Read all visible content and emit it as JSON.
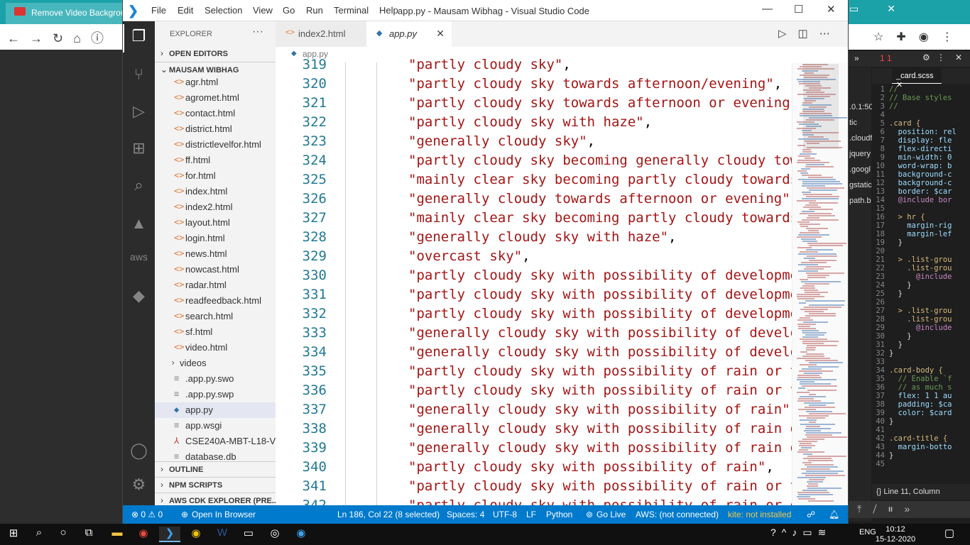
{
  "browser": {
    "tab_title": "Remove Video Backgrou"
  },
  "window": {
    "title": "app.py - Mausam Wibhag - Visual Studio Code",
    "menu": [
      "File",
      "Edit",
      "Selection",
      "View",
      "Go",
      "Run",
      "Terminal",
      "Help"
    ]
  },
  "activity_bar": [
    "explorer-icon",
    "source-control-icon",
    "run-debug-icon",
    "extensions-icon",
    "search-icon",
    "azure-icon",
    "aws-icon",
    "docker-icon",
    "account-icon",
    "settings-gear-icon"
  ],
  "sidebar": {
    "header": "EXPLORER",
    "more": "···",
    "open_editors": "OPEN EDITORS",
    "project": "MAUSAM WIBHAG",
    "files": [
      {
        "name": "agr.html",
        "type": "html"
      },
      {
        "name": "agromet.html",
        "type": "html"
      },
      {
        "name": "contact.html",
        "type": "html"
      },
      {
        "name": "district.html",
        "type": "html"
      },
      {
        "name": "districtlevelfor.html",
        "type": "html"
      },
      {
        "name": "ff.html",
        "type": "html"
      },
      {
        "name": "for.html",
        "type": "html"
      },
      {
        "name": "index.html",
        "type": "html"
      },
      {
        "name": "index2.html",
        "type": "html"
      },
      {
        "name": "layout.html",
        "type": "html"
      },
      {
        "name": "login.html",
        "type": "html"
      },
      {
        "name": "news.html",
        "type": "html"
      },
      {
        "name": "nowcast.html",
        "type": "html"
      },
      {
        "name": "radar.html",
        "type": "html"
      },
      {
        "name": "readfeedback.html",
        "type": "html"
      },
      {
        "name": "search.html",
        "type": "html"
      },
      {
        "name": "sf.html",
        "type": "html"
      },
      {
        "name": "video.html",
        "type": "html"
      },
      {
        "name": "videos",
        "type": "folder"
      },
      {
        "name": ".app.py.swo",
        "type": "text"
      },
      {
        "name": ".app.py.swp",
        "type": "text"
      },
      {
        "name": "app.py",
        "type": "python"
      },
      {
        "name": "app.wsgi",
        "type": "text"
      },
      {
        "name": "CSE240A-MBT-L18-Vi...",
        "type": "pdf"
      },
      {
        "name": "database.db",
        "type": "text"
      }
    ],
    "outline": "OUTLINE",
    "npm_scripts": "NPM SCRIPTS",
    "aws_cdk": "AWS CDK EXPLORER (PRE..."
  },
  "tabs": [
    {
      "label": "index2.html",
      "icon": "<>"
    },
    {
      "label": "app.py",
      "icon": "py"
    }
  ],
  "breadcrumb": "app.py",
  "code": {
    "lines": [
      {
        "n": "319",
        "text": "\"partly cloudy sky\"",
        "comma": ","
      },
      {
        "n": "320",
        "text": "\"partly cloudy sky towards afternoon/evening\"",
        "comma": ","
      },
      {
        "n": "321",
        "text": "\"partly cloudy sky towards afternoon or evening\"",
        "comma": ","
      },
      {
        "n": "322",
        "text": "\"partly cloudy sky with haze\"",
        "comma": ","
      },
      {
        "n": "323",
        "text": "\"generally cloudy sky\"",
        "comma": ","
      },
      {
        "n": "324",
        "text": "\"partly cloudy sky becoming generally cloudy towar",
        "comma": ""
      },
      {
        "n": "325",
        "text": "\"mainly clear sky becoming partly cloudy towards a",
        "comma": ""
      },
      {
        "n": "326",
        "text": "\"generally cloudy towards afternoon or evening\"",
        "comma": ","
      },
      {
        "n": "327",
        "text": "\"mainly clear sky becoming partly cloudy towards a",
        "comma": ""
      },
      {
        "n": "328",
        "text": "\"generally cloudy sky with haze\"",
        "comma": ","
      },
      {
        "n": "329",
        "text": "\"overcast sky\"",
        "comma": ","
      },
      {
        "n": "330",
        "text": "\"partly cloudy sky with possibility of development",
        "comma": ""
      },
      {
        "n": "331",
        "text": "\"partly cloudy sky with possibility of development",
        "comma": ""
      },
      {
        "n": "332",
        "text": "\"partly cloudy sky with possibility of development",
        "comma": ""
      },
      {
        "n": "333",
        "text": "\"generally cloudy sky with possibility of developm",
        "comma": ""
      },
      {
        "n": "334",
        "text": "\"generally cloudy sky with possibility of developm",
        "comma": ""
      },
      {
        "n": "335",
        "text": "\"partly cloudy sky with possibility of rain or thu",
        "comma": ""
      },
      {
        "n": "336",
        "text": "\"partly cloudy sky with possibility of rain or thu",
        "comma": ""
      },
      {
        "n": "337",
        "text": "\"generally cloudy sky with possibility of rain\"",
        "comma": ","
      },
      {
        "n": "338",
        "text": "\"generally cloudy sky with possibility of rain or",
        "comma": ""
      },
      {
        "n": "339",
        "text": "\"generally cloudy sky with possibility of rain or",
        "comma": ""
      },
      {
        "n": "340",
        "text": "\"partly cloudy sky with possibility of rain\"",
        "comma": ","
      },
      {
        "n": "341",
        "text": "\"partly cloudy sky with possibility of rain or thu",
        "comma": ""
      },
      {
        "n": "342",
        "text": "\"partly cloudy sky with possibility of rain or du",
        "comma": ""
      }
    ]
  },
  "statusbar": {
    "errors": "⊗ 0 ⚠ 0",
    "open_browser": "Open In Browser",
    "position": "Ln 186, Col 22 (8 selected)",
    "spaces": "Spaces: 4",
    "encoding": "UTF-8",
    "eol": "LF",
    "language": "Python",
    "go_live": "Go Live",
    "aws": "AWS: (not connected)",
    "kite": "kite: not installed"
  },
  "devtools": {
    "file_tab": "_card.scss",
    "counts": "1 1",
    "status": "Line 11, Column",
    "strip_text": [
      ".0.1:50",
      "tic",
      "",
      "",
      ".cloudf",
      "jquery",
      ".googl",
      "gstatic",
      "path.b"
    ],
    "scss_lines": [
      {
        "n": "1",
        "t": "//",
        "c": "#6a9955"
      },
      {
        "n": "2",
        "t": "// Base styles",
        "c": "#6a9955"
      },
      {
        "n": "3",
        "t": "//",
        "c": "#6a9955"
      },
      {
        "n": "4",
        "t": "",
        "c": "#ddd"
      },
      {
        "n": "5",
        "t": ".card {",
        "c": "#d7ba7d"
      },
      {
        "n": "6",
        "t": "  position: rel",
        "c": "#9cdcfe"
      },
      {
        "n": "7",
        "t": "  display: fle",
        "c": "#9cdcfe"
      },
      {
        "n": "8",
        "t": "  flex-directi",
        "c": "#9cdcfe"
      },
      {
        "n": "9",
        "t": "  min-width: 0",
        "c": "#9cdcfe"
      },
      {
        "n": "10",
        "t": "  word-wrap: b",
        "c": "#9cdcfe"
      },
      {
        "n": "11",
        "t": "  background-c",
        "c": "#9cdcfe"
      },
      {
        "n": "12",
        "t": "  background-c",
        "c": "#9cdcfe"
      },
      {
        "n": "13",
        "t": "  border: $car",
        "c": "#9cdcfe"
      },
      {
        "n": "14",
        "t": "  @include bor",
        "c": "#c586c0"
      },
      {
        "n": "15",
        "t": "",
        "c": "#ddd"
      },
      {
        "n": "16",
        "t": "  > hr {",
        "c": "#d7ba7d"
      },
      {
        "n": "17",
        "t": "    margin-rig",
        "c": "#9cdcfe"
      },
      {
        "n": "18",
        "t": "    margin-lef",
        "c": "#9cdcfe"
      },
      {
        "n": "19",
        "t": "  }",
        "c": "#ddd"
      },
      {
        "n": "20",
        "t": "",
        "c": "#ddd"
      },
      {
        "n": "21",
        "t": "  > .list-grou",
        "c": "#d7ba7d"
      },
      {
        "n": "22",
        "t": "    .list-grou",
        "c": "#d7ba7d"
      },
      {
        "n": "23",
        "t": "      @include",
        "c": "#c586c0"
      },
      {
        "n": "24",
        "t": "    }",
        "c": "#ddd"
      },
      {
        "n": "25",
        "t": "  }",
        "c": "#ddd"
      },
      {
        "n": "26",
        "t": "",
        "c": "#ddd"
      },
      {
        "n": "27",
        "t": "  > .list-grou",
        "c": "#d7ba7d"
      },
      {
        "n": "28",
        "t": "    .list-grou",
        "c": "#d7ba7d"
      },
      {
        "n": "29",
        "t": "      @include",
        "c": "#c586c0"
      },
      {
        "n": "30",
        "t": "    }",
        "c": "#ddd"
      },
      {
        "n": "31",
        "t": "  }",
        "c": "#ddd"
      },
      {
        "n": "32",
        "t": "}",
        "c": "#ddd"
      },
      {
        "n": "33",
        "t": "",
        "c": "#ddd"
      },
      {
        "n": "34",
        "t": ".card-body {",
        "c": "#d7ba7d"
      },
      {
        "n": "35",
        "t": "  // Enable `f",
        "c": "#6a9955"
      },
      {
        "n": "36",
        "t": "  // as much s",
        "c": "#6a9955"
      },
      {
        "n": "37",
        "t": "  flex: 1 1 au",
        "c": "#9cdcfe"
      },
      {
        "n": "38",
        "t": "  padding: $ca",
        "c": "#9cdcfe"
      },
      {
        "n": "39",
        "t": "  color: $card",
        "c": "#9cdcfe"
      },
      {
        "n": "40",
        "t": "}",
        "c": "#ddd"
      },
      {
        "n": "41",
        "t": "",
        "c": "#ddd"
      },
      {
        "n": "42",
        "t": ".card-title {",
        "c": "#d7ba7d"
      },
      {
        "n": "43",
        "t": "  margin-botto",
        "c": "#9cdcfe"
      },
      {
        "n": "44",
        "t": "}",
        "c": "#ddd"
      },
      {
        "n": "45",
        "t": "",
        "c": "#ddd"
      }
    ]
  },
  "taskbar": {
    "language": "ENG",
    "time": "10:12",
    "date": "15-12-2020"
  }
}
